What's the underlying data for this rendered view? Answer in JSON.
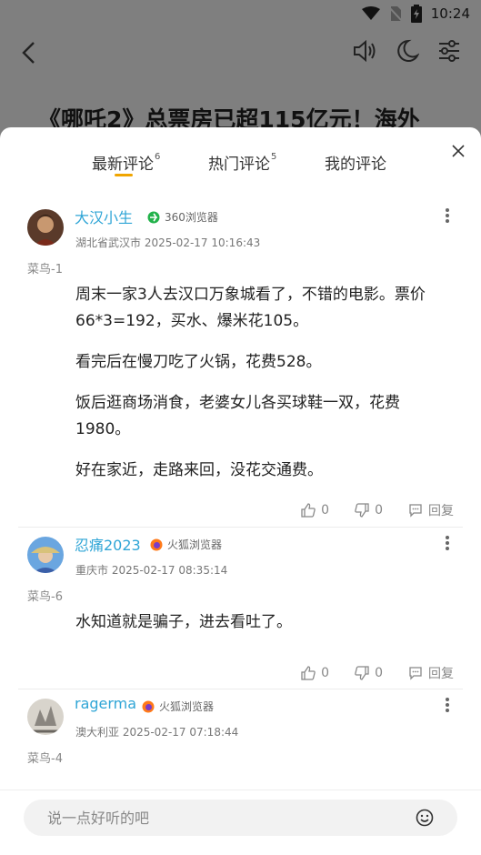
{
  "status": {
    "time": "10:24"
  },
  "article": {
    "title": "《哪吒2》总票房已超115亿元！海外"
  },
  "tabs": [
    {
      "label": "最新评论",
      "count": "6"
    },
    {
      "label": "热门评论",
      "count": "5"
    },
    {
      "label": "我的评论",
      "count": ""
    }
  ],
  "comments": [
    {
      "username": "大汉小生",
      "browser": "360浏览器",
      "location_time": "湖北省武汉市 2025-02-17 10:16:43",
      "level": "菜鸟-1",
      "paragraphs": [
        "周末一家3人去汉口万象城看了，不错的电影。票价66*3=192，买水、爆米花105。",
        "看完后在慢刀吃了火锅，花费528。",
        "饭后逛商场消食，老婆女儿各买球鞋一双，花费1980。",
        "好在家近，走路来回，没花交通费。"
      ],
      "likes": "0",
      "dislikes": "0",
      "reply": "回复"
    },
    {
      "username": "忍痛2023",
      "browser": "火狐浏览器",
      "location_time": "重庆市 2025-02-17 08:35:14",
      "level": "菜鸟-6",
      "paragraphs": [
        "水知道就是骗子，进去看吐了。"
      ],
      "likes": "0",
      "dislikes": "0",
      "reply": "回复"
    },
    {
      "username": "ragerma",
      "browser": "火狐浏览器",
      "location_time": "澳大利亚 2025-02-17 07:18:44",
      "level": "菜鸟-4",
      "paragraphs": [],
      "likes": "",
      "dislikes": "",
      "reply": ""
    }
  ],
  "input": {
    "placeholder": "说一点好听的吧"
  },
  "colors": {
    "accent": "#f0a500",
    "username": "#2fa5d6"
  }
}
